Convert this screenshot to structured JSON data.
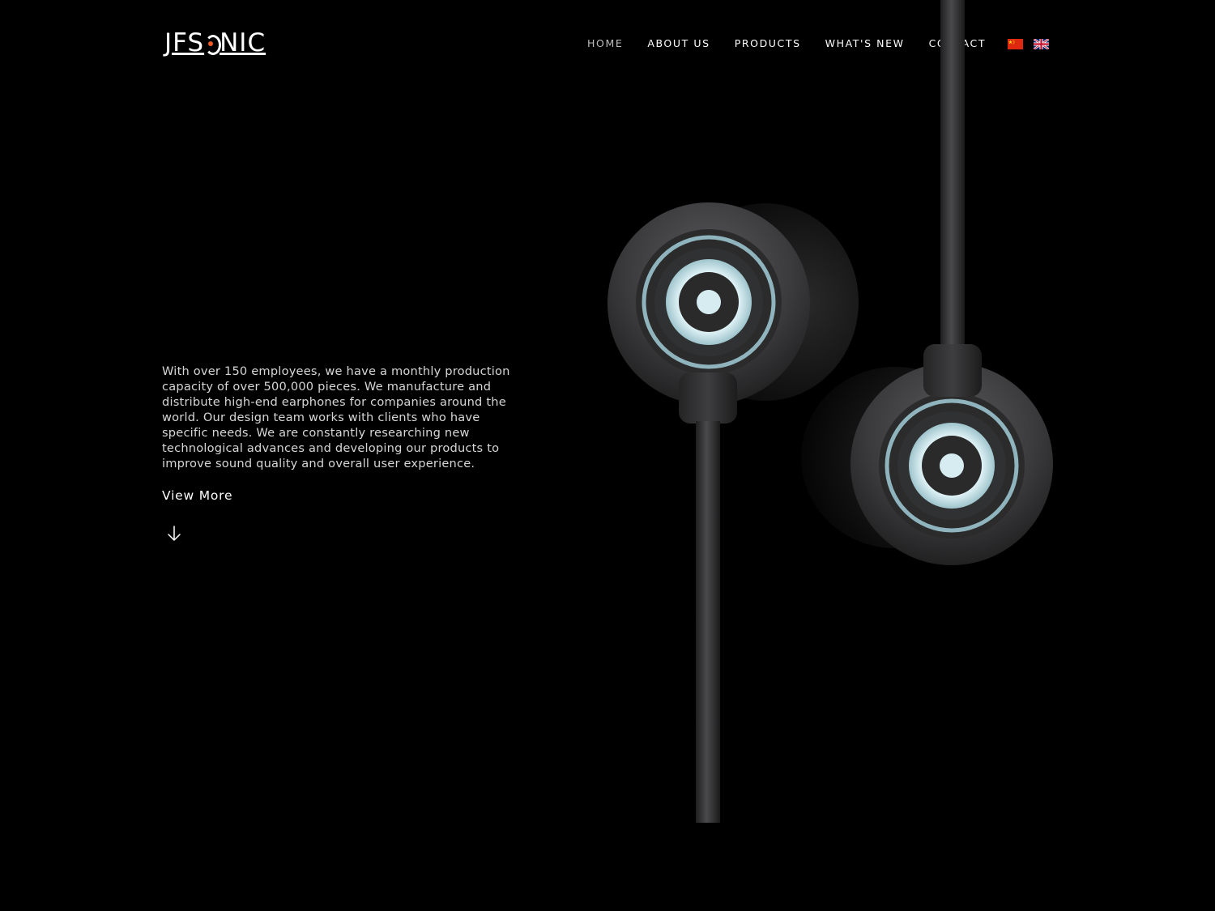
{
  "brand": {
    "logo_prefix": "JFS",
    "logo_suffix": "NIC",
    "accent": "#f15a22"
  },
  "nav": {
    "items": [
      {
        "label": "HOME",
        "active": true
      },
      {
        "label": "ABOUT US",
        "active": false
      },
      {
        "label": "PRODUCTS",
        "active": false
      },
      {
        "label": "WHAT'S NEW",
        "active": false
      },
      {
        "label": "CONTACT",
        "active": false
      }
    ],
    "languages": [
      {
        "icon": "china-flag-icon"
      },
      {
        "icon": "uk-flag-icon"
      }
    ]
  },
  "hero": {
    "description": "With over 150 employees, we have a monthly production capacity of over 500,000 pieces. We manufacture and distribute high-end earphones for companies around the world. Our design team works with clients who have specific needs. We are constantly researching new technological advances and developing our products to improve sound quality and overall user experience.",
    "cta_label": "View More",
    "scroll_icon": "arrow-down-icon",
    "image": "earphones-product-image"
  },
  "colors": {
    "background": "#000000",
    "text": "#ffffff",
    "muted_text": "#d6d6d6",
    "active_nav": "#bdbdbd",
    "driver_accent": "#c8e4ec"
  }
}
